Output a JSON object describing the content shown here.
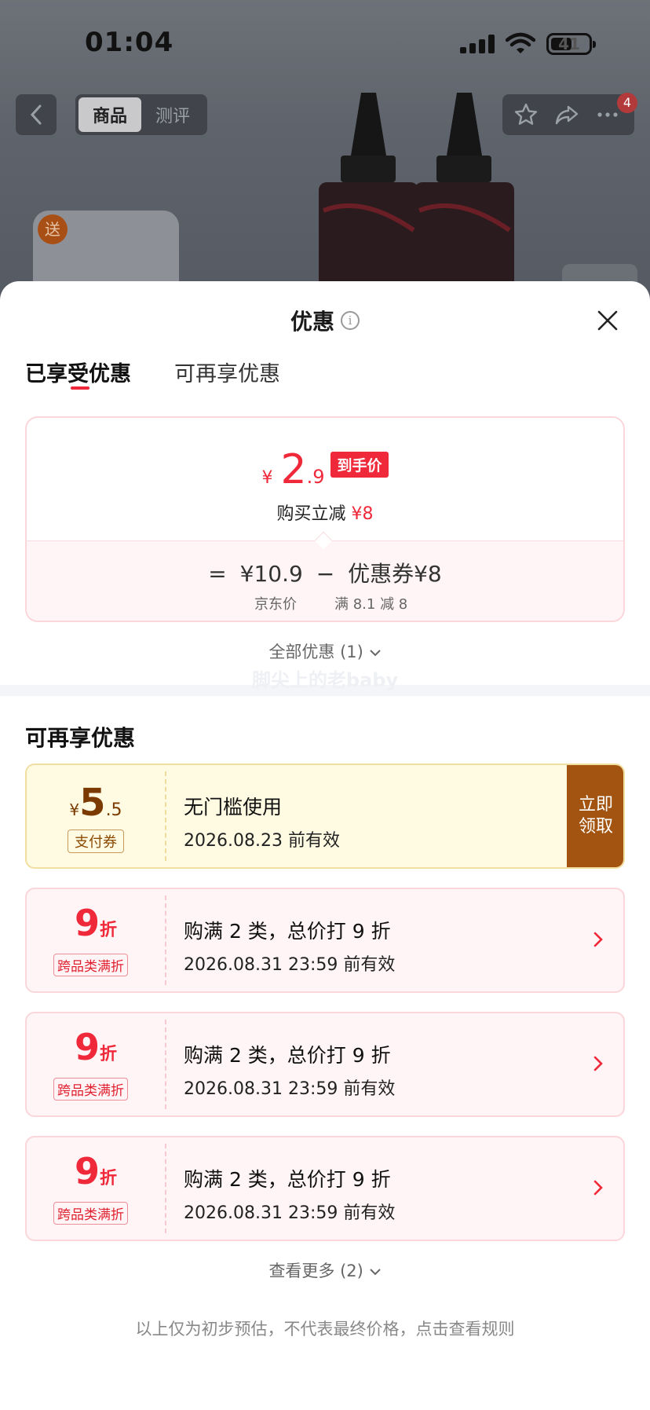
{
  "status_bar": {
    "time": "01:04",
    "battery": "41"
  },
  "product_header": {
    "tabs": [
      "商品",
      "测评"
    ],
    "active_tab": "商品",
    "cart_badge": "4",
    "gift_badge": "送"
  },
  "sheet": {
    "title": "优惠",
    "tabs": {
      "enjoyed": "已享受优惠",
      "more": "可再享优惠"
    },
    "enjoyed_card": {
      "currency": "¥",
      "price_int": "2",
      "price_dec": ".9",
      "price_tag": "到手价",
      "instant_label": "购买立减",
      "instant_value": "¥8",
      "eq_sign": "=",
      "jd_price": "¥10.9",
      "minus_sign": "−",
      "coupon_text": "优惠券¥8",
      "jd_price_label": "京东价",
      "coupon_rule": "满 8.1 减 8"
    },
    "all_offers": "全部优惠 (1)",
    "watermark": "脚尖上的老baby",
    "more_section_title": "可再享优惠",
    "coupons": [
      {
        "kind": "gold",
        "currency": "¥",
        "amount_int": "5",
        "amount_dec": ".5",
        "tag": "支付券",
        "title": "无门槛使用",
        "date": "2026.08.23 前有效",
        "button": "立即\n领取"
      },
      {
        "kind": "pink",
        "amount": "9",
        "unit": "折",
        "tag": "跨品类满折",
        "title": "购满 2 类，总价打 9 折",
        "date": "2026.08.31 23:59 前有效"
      },
      {
        "kind": "pink",
        "amount": "9",
        "unit": "折",
        "tag": "跨品类满折",
        "title": "购满 2 类，总价打 9 折",
        "date": "2026.08.31 23:59 前有效"
      },
      {
        "kind": "pink",
        "amount": "9",
        "unit": "折",
        "tag": "跨品类满折",
        "title": "购满 2 类，总价打 9 折",
        "date": "2026.08.31 23:59 前有效"
      }
    ],
    "see_more": "查看更多 (2)",
    "disclaimer": "以上仅为初步预估，不代表最终价格，点击查看规则"
  },
  "colors": {
    "accent_red": "#f0293a",
    "gold_bg": "#fffbe3",
    "claim_brown": "#a25410",
    "pink_bg": "#fff5f6"
  }
}
